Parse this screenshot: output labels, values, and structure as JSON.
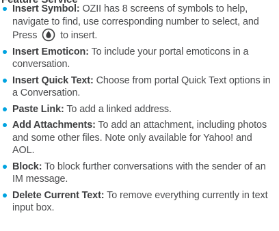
{
  "page": {
    "heading_cut": "Feature Service"
  },
  "items": [
    {
      "term": "Insert Symbol:",
      "desc": " OZII has 8 screens of symbols to help, navigate to find, use corresponding number to select, and Press ",
      "desc_after": " to insert.",
      "icon": "ok-button-icon"
    },
    {
      "term": "Insert Emoticon:",
      "desc": " To include your portal emoticons in a conversation."
    },
    {
      "term": "Insert Quick Text:",
      "desc": " Choose from portal Quick Text options in a Conversation."
    },
    {
      "term": "Paste Link:",
      "desc": " To add a linked address."
    },
    {
      "term": "Add Attachments:",
      "desc": " To add an attachment, including photos and some other files.  Note only available for Yahoo! and AOL."
    },
    {
      "term": "Block:",
      "desc": " To block further conversations with the sender of an IM message."
    },
    {
      "term": "Delete Current Text:",
      "desc": " To remove everything currently in text input box."
    }
  ],
  "colors": {
    "bullet": "#00a3e0",
    "text": "#4a4b4d",
    "term": "#3d3e40"
  }
}
